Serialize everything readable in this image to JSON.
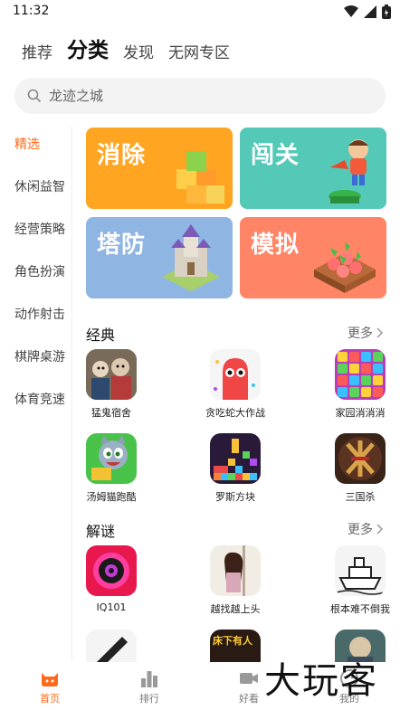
{
  "status": {
    "time": "11:32"
  },
  "top_tabs": [
    {
      "label": "推荐"
    },
    {
      "label": "分类"
    },
    {
      "label": "发现"
    },
    {
      "label": "无网专区"
    }
  ],
  "search": {
    "placeholder": "龙迹之城"
  },
  "sidebar": {
    "items": [
      {
        "label": "精选"
      },
      {
        "label": "休闲益智"
      },
      {
        "label": "经营策略"
      },
      {
        "label": "角色扮演"
      },
      {
        "label": "动作射击"
      },
      {
        "label": "棋牌桌游"
      },
      {
        "label": "体育竞速"
      }
    ]
  },
  "category_tiles": [
    {
      "label": "消除",
      "color": "#ffa522"
    },
    {
      "label": "闯关",
      "color": "#54c9b8"
    },
    {
      "label": "塔防",
      "color": "#8fb5e3"
    },
    {
      "label": "模拟",
      "color": "#ff8566"
    }
  ],
  "sections": [
    {
      "title": "经典",
      "more": "更多",
      "games": [
        {
          "name": "猛鬼宿舍"
        },
        {
          "name": "贪吃蛇大作战"
        },
        {
          "name": "家园消消消"
        },
        {
          "name": "汤姆猫跑酷"
        },
        {
          "name": "罗斯方块"
        },
        {
          "name": "三国杀"
        }
      ]
    },
    {
      "title": "解谜",
      "more": "更多",
      "games": [
        {
          "name": "IQ101"
        },
        {
          "name": "越找越上头"
        },
        {
          "name": "根本难不倒我"
        }
      ]
    }
  ],
  "bottom_nav": [
    {
      "label": "首页"
    },
    {
      "label": "排行"
    },
    {
      "label": "好看"
    },
    {
      "label": "我的"
    }
  ],
  "partial_icons": {
    "icon2_text": "床下有人"
  },
  "watermark": "大玩客",
  "colors": {
    "accent": "#ff6a1a"
  }
}
